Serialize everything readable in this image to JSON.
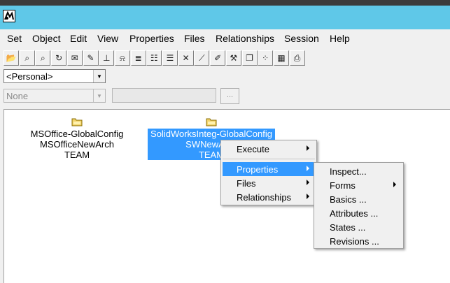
{
  "menubar": {
    "items": [
      "Set",
      "Object",
      "Edit",
      "View",
      "Properties",
      "Files",
      "Relationships",
      "Session",
      "Help"
    ]
  },
  "toolbar": {
    "icons": [
      {
        "name": "open-folder-icon",
        "glyph": "📂"
      },
      {
        "name": "binoculars-icon",
        "glyph": "⌕"
      },
      {
        "name": "find-folder-icon",
        "glyph": "⌕"
      },
      {
        "name": "document-refresh-icon",
        "glyph": "↻"
      },
      {
        "name": "mail-icon",
        "glyph": "✉"
      },
      {
        "name": "document-edit-icon",
        "glyph": "✎"
      },
      {
        "name": "stamp-icon",
        "glyph": "⊥"
      },
      {
        "name": "bell-icon",
        "glyph": "⍾"
      },
      {
        "name": "report-icon",
        "glyph": "≣"
      },
      {
        "name": "properties-list-icon",
        "glyph": "☷"
      },
      {
        "name": "list-icon",
        "glyph": "☰"
      },
      {
        "name": "expand-icon",
        "glyph": "✕"
      },
      {
        "name": "link-icon",
        "glyph": "⟋"
      },
      {
        "name": "pencil-icon",
        "glyph": "✐"
      },
      {
        "name": "tools-icon",
        "glyph": "⚒"
      },
      {
        "name": "book-icon",
        "glyph": "❐"
      },
      {
        "name": "dots-icon",
        "glyph": "⁘"
      },
      {
        "name": "table-icon",
        "glyph": "▦"
      },
      {
        "name": "printer-icon",
        "glyph": "⎙"
      }
    ]
  },
  "set_combo": {
    "value": "<Personal>"
  },
  "filter_combo": {
    "value": "None"
  },
  "browse_button": {
    "label": "..."
  },
  "nodes": [
    {
      "lines": [
        "MSOffice-GlobalConfig",
        "MSOfficeNewArch",
        "TEAM"
      ],
      "selected": false
    },
    {
      "lines": [
        "SolidWorksInteg-GlobalConfig",
        "SWNewArch",
        "TEAM"
      ],
      "selected": true
    }
  ],
  "context_menu": {
    "items": [
      {
        "label": "Execute",
        "submenu": true,
        "highlighted": false
      },
      {
        "label": "Properties",
        "submenu": true,
        "highlighted": true
      },
      {
        "label": "Files",
        "submenu": true,
        "highlighted": false
      },
      {
        "label": "Relationships",
        "submenu": true,
        "highlighted": false
      }
    ]
  },
  "properties_submenu": {
    "items": [
      {
        "label": "Inspect...",
        "submenu": false
      },
      {
        "label": "Forms",
        "submenu": true
      },
      {
        "label": "Basics ...",
        "submenu": false
      },
      {
        "label": "Attributes ...",
        "submenu": false
      },
      {
        "label": "States ...",
        "submenu": false
      },
      {
        "label": "Revisions ...",
        "submenu": false
      }
    ]
  },
  "colors": {
    "titlebar": "#5fc8e8",
    "selection": "#3399ff"
  }
}
